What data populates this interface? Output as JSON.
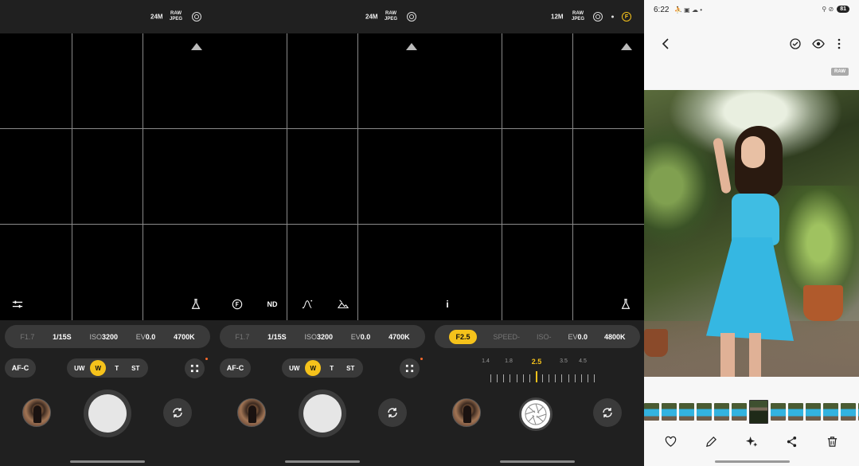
{
  "panels": [
    {
      "top": {
        "megapixels": "24M",
        "raw1": "RAW",
        "raw2": "JPEG"
      },
      "viewfinder_icons": [
        "sliders-icon",
        "flask-icon"
      ],
      "params": [
        {
          "label": "F1.7",
          "style": "dim"
        },
        {
          "label": "1/15S",
          "style": "bold"
        },
        {
          "prefix": "ISO",
          "value": "3200"
        },
        {
          "prefix": "EV",
          "value": "0.0"
        },
        {
          "label": "4700K",
          "style": "bold"
        }
      ],
      "focus_mode": "AF-C",
      "lenses": [
        "UW",
        "W",
        "T",
        "ST"
      ],
      "active_lens": "W"
    },
    {
      "top": {
        "megapixels": "24M",
        "raw1": "RAW",
        "raw2": "JPEG"
      },
      "viewfinder_icons": [
        "f-icon",
        "nd",
        "curve-icon",
        "mountain-icon"
      ],
      "nd_label": "ND",
      "params": [
        {
          "label": "F1.7",
          "style": "dim"
        },
        {
          "label": "1/15S",
          "style": "bold"
        },
        {
          "prefix": "ISO",
          "value": "3200"
        },
        {
          "prefix": "EV",
          "value": "0.0"
        },
        {
          "label": "4700K",
          "style": "bold"
        }
      ],
      "focus_mode": "AF-C",
      "lenses": [
        "UW",
        "W",
        "T",
        "ST"
      ],
      "active_lens": "W"
    },
    {
      "top": {
        "megapixels": "12M",
        "raw1": "RAW",
        "raw2": "JPEG"
      },
      "viewfinder_icons": [
        "overlap-icon",
        "close-icon",
        "info-icon",
        "flask-icon"
      ],
      "close_label": "×",
      "info_label": "i",
      "params": [
        {
          "label": "F2.5",
          "style": "highlight"
        },
        {
          "label": "SPEED-",
          "style": "dim"
        },
        {
          "label": "ISO-",
          "style": "dim"
        },
        {
          "prefix": "EV",
          "value": "0.0"
        },
        {
          "label": "4800K",
          "style": "bold"
        }
      ],
      "aperture_values": [
        "1.4",
        "1.8",
        "2.5",
        "3.5",
        "4.5"
      ],
      "aperture_selected": "2.5"
    }
  ],
  "gallery": {
    "time": "6:22",
    "status_icons": "⛹ ▣ ☁ •",
    "right_icons": "⚲ ⊘",
    "battery": "81",
    "raw_badge": "RAW"
  }
}
